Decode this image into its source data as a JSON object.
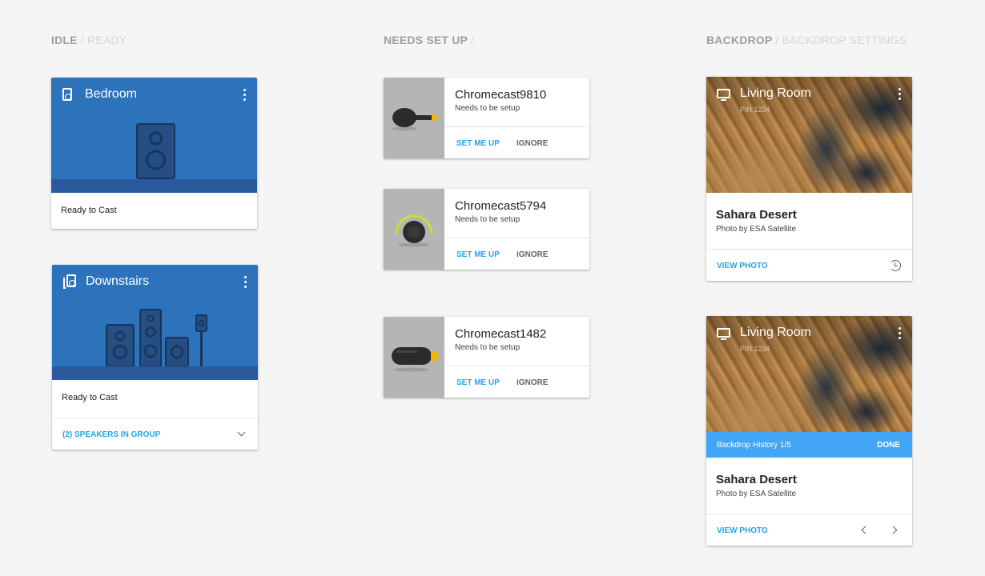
{
  "columns": [
    {
      "title": "IDLE",
      "subtitle": "/ READY"
    },
    {
      "title": "NEEDS SET UP",
      "subtitle": "/"
    },
    {
      "title": "BACKDROP",
      "subtitle": "/ BACKDROP SETTINGS"
    }
  ],
  "speakers": [
    {
      "name": "Bedroom",
      "status": "Ready to Cast"
    },
    {
      "name": "Downstairs",
      "status": "Ready to Cast",
      "group_label": "(2) SPEAKERS IN GROUP"
    }
  ],
  "setup_devices": [
    {
      "name": "Chromecast9810",
      "status": "Needs to be setup",
      "primary_action": "SET ME UP",
      "secondary_action": "IGNORE"
    },
    {
      "name": "Chromecast5794",
      "status": "Needs to be setup",
      "primary_action": "SET ME UP",
      "secondary_action": "IGNORE"
    },
    {
      "name": "Chromecast1482",
      "status": "Needs to be setup",
      "primary_action": "SET ME UP",
      "secondary_action": "IGNORE"
    }
  ],
  "backdrops": [
    {
      "room": "Living Room",
      "pin": "PIN 1234",
      "photo_title": "Sahara Desert",
      "photo_credit": "Photo by ESA Satellite",
      "view_label": "VIEW PHOTO"
    },
    {
      "room": "Living Room",
      "pin": "PIN 1234",
      "history_label": "Backdrop History 1/5",
      "done_label": "DONE",
      "photo_title": "Sahara Desert",
      "photo_credit": "Photo by ESA Satellite",
      "view_label": "VIEW PHOTO"
    }
  ],
  "colors": {
    "accent": "#26a3e6",
    "speaker_bg": "#2d73bb",
    "speaker_floor": "#2a5a9d",
    "history_bar": "#42a5f5"
  }
}
